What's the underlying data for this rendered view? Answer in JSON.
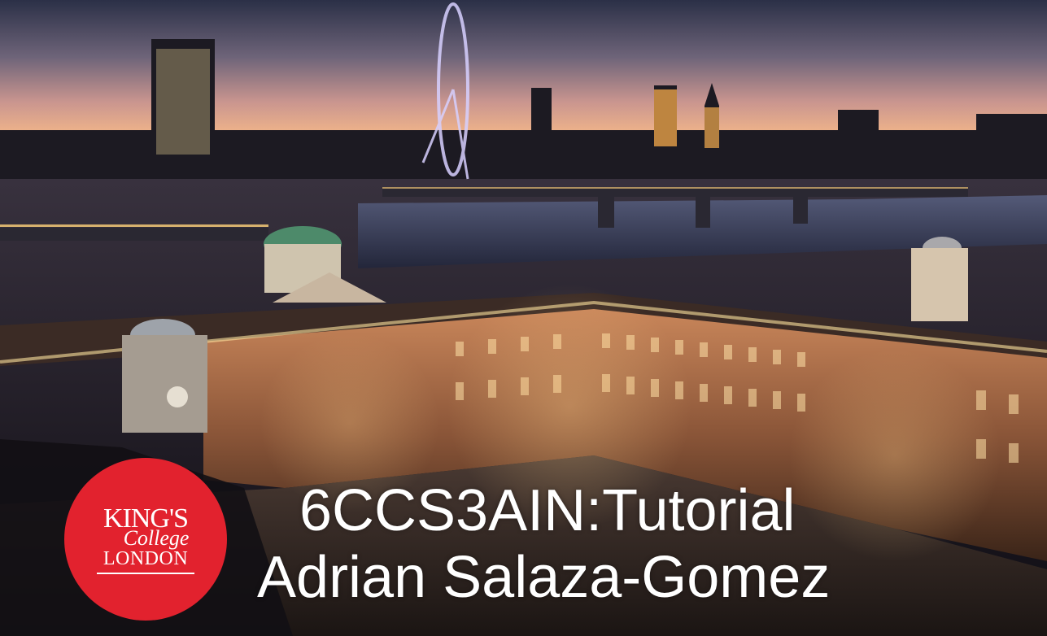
{
  "slide": {
    "title": "6CCS3AIN:Tutorial",
    "presenter": "Adrian Salaza-Gomez"
  },
  "logo": {
    "line1": "KING'S",
    "line2": "College",
    "line3": "LONDON",
    "color": "#e2222e"
  },
  "background": {
    "description_icon": "london-skyline-photo",
    "sky_top": "#2b3047",
    "sky_mid": "#b98a8f",
    "sky_horizon": "#f0b48a",
    "river": "#2a2e45",
    "building_light": "#e8a06a"
  }
}
